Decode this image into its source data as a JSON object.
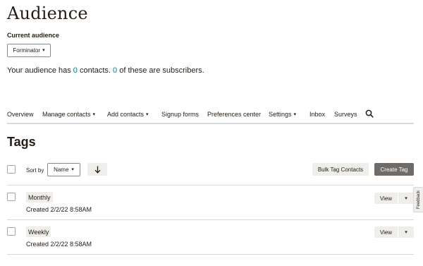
{
  "header": {
    "title": "Audience",
    "current_audience_label": "Current audience",
    "audience_select_value": "Forminator"
  },
  "summary": {
    "prefix": "Your audience has ",
    "contacts_count": "0",
    "middle": " contacts. ",
    "subscribers_count": "0",
    "suffix": " of these are subscribers."
  },
  "nav": {
    "items": [
      {
        "label": "Overview",
        "has_dropdown": false
      },
      {
        "label": "Manage contacts",
        "has_dropdown": true
      },
      {
        "label": "Add contacts",
        "has_dropdown": true
      },
      {
        "label": "Signup forms",
        "has_dropdown": false
      },
      {
        "label": "Preferences center",
        "has_dropdown": false
      },
      {
        "label": "Settings",
        "has_dropdown": true
      },
      {
        "label": "Inbox",
        "has_dropdown": false
      },
      {
        "label": "Surveys",
        "has_dropdown": false
      }
    ],
    "search_icon": "search-icon"
  },
  "tags": {
    "title": "Tags",
    "sort_by_label": "Sort by",
    "sort_select_value": "Name",
    "sort_direction_icon": "arrow-down-icon",
    "bulk_button": "Bulk Tag Contacts",
    "create_button": "Create Tag",
    "rows": [
      {
        "name": "Monthly",
        "created": "Created 2/2/22 8:58AM",
        "view_label": "View"
      },
      {
        "name": "Weekly",
        "created": "Created 2/2/22 8:58AM",
        "view_label": "View"
      }
    ]
  },
  "feedback": {
    "label": "Feedback"
  },
  "colors": {
    "accent_link": "#007c89",
    "primary_button": "#6e6b68",
    "secondary_button": "#efeeea",
    "divider": "#d9d9d9",
    "text": "#241c15"
  }
}
